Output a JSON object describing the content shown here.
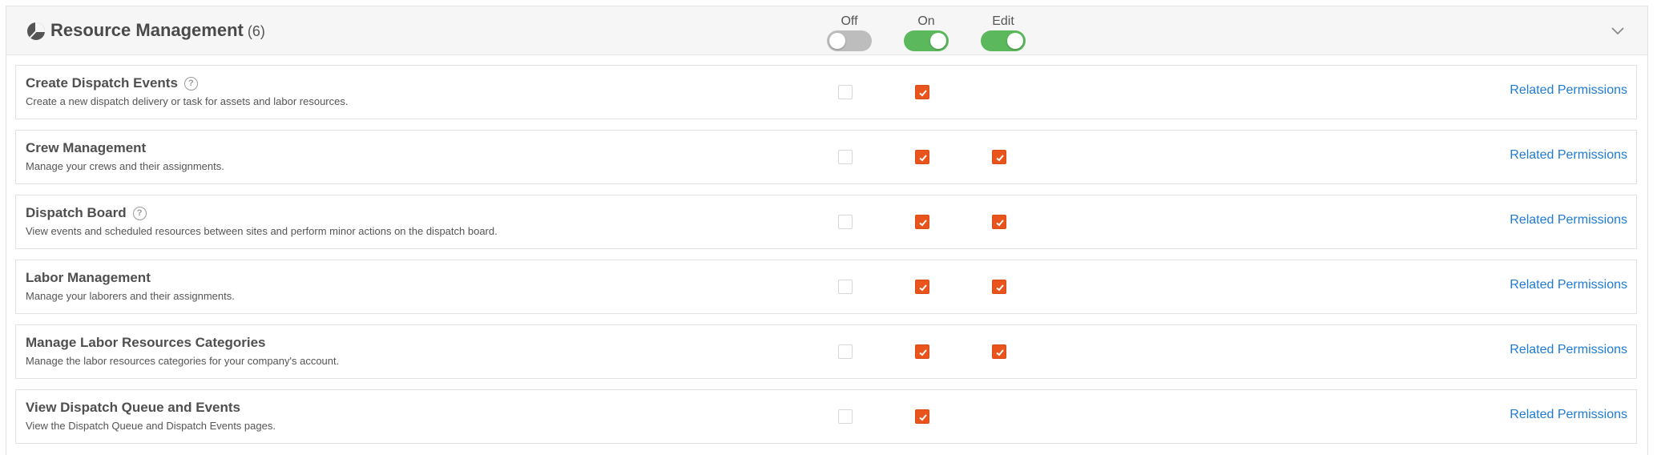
{
  "section": {
    "title": "Resource Management",
    "count": "(6)",
    "icon": "pie-chart-icon"
  },
  "columns": {
    "off_label": "Off",
    "on_label": "On",
    "edit_label": "Edit"
  },
  "toggles": {
    "off_state": false,
    "on_state": true,
    "edit_state": true
  },
  "colors": {
    "toggle_on": "#5cb85c",
    "toggle_off": "#bdbdbd",
    "checkbox_checked": "#e8541c",
    "link": "#1f7bd2"
  },
  "rows": [
    {
      "title": "Create Dispatch Events",
      "help": true,
      "description": "Create a new dispatch delivery or task for assets and labor resources.",
      "off": false,
      "on": true,
      "edit": null,
      "link": "Related Permissions"
    },
    {
      "title": "Crew Management",
      "help": false,
      "description": "Manage your crews and their assignments.",
      "off": false,
      "on": true,
      "edit": true,
      "link": "Related Permissions"
    },
    {
      "title": "Dispatch Board",
      "help": true,
      "description": "View events and scheduled resources between sites and perform minor actions on the dispatch board.",
      "off": false,
      "on": true,
      "edit": true,
      "link": "Related Permissions"
    },
    {
      "title": "Labor Management",
      "help": false,
      "description": "Manage your laborers and their assignments.",
      "off": false,
      "on": true,
      "edit": true,
      "link": "Related Permissions"
    },
    {
      "title": "Manage Labor Resources Categories",
      "help": false,
      "description": "Manage the labor resources categories for your company's account.",
      "off": false,
      "on": true,
      "edit": true,
      "link": "Related Permissions"
    },
    {
      "title": "View Dispatch Queue and Events",
      "help": false,
      "description": "View the Dispatch Queue and Dispatch Events pages.",
      "off": false,
      "on": true,
      "edit": null,
      "link": "Related Permissions"
    }
  ]
}
